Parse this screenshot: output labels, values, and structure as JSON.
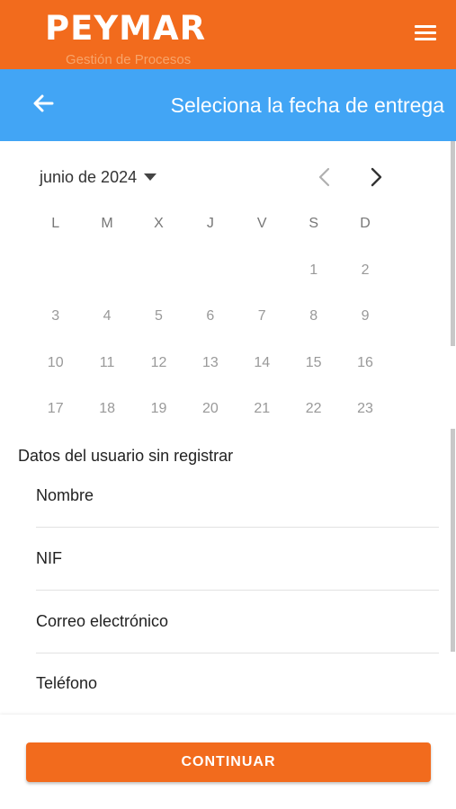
{
  "header": {
    "brand": "PEYMAR",
    "tagline": "Gestión de Procesos",
    "menu_icon": "hamburger-menu-icon",
    "brand_color": "#f26b1d"
  },
  "subheader": {
    "back_icon": "arrow-left-icon",
    "title": "Seleciona la fecha de entrega",
    "color": "#42a5f5"
  },
  "calendar": {
    "month": "junio de 2024",
    "dropdown_icon": "caret-down-icon",
    "prev_icon": "chevron-left-icon",
    "next_icon": "chevron-right-icon",
    "weekdays": [
      "L",
      "M",
      "X",
      "J",
      "V",
      "S",
      "D"
    ],
    "weeks": [
      [
        "",
        "",
        "",
        "",
        "",
        "1",
        "2"
      ],
      [
        "3",
        "4",
        "5",
        "6",
        "7",
        "8",
        "9"
      ],
      [
        "10",
        "11",
        "12",
        "13",
        "14",
        "15",
        "16"
      ],
      [
        "17",
        "18",
        "19",
        "20",
        "21",
        "22",
        "23"
      ]
    ]
  },
  "form": {
    "section_title": "Datos del usuario sin registrar",
    "fields": [
      {
        "label": "Nombre"
      },
      {
        "label": "NIF"
      },
      {
        "label": "Correo electrónico"
      },
      {
        "label": "Teléfono"
      }
    ]
  },
  "footer": {
    "continue_label": "CONTINUAR"
  }
}
